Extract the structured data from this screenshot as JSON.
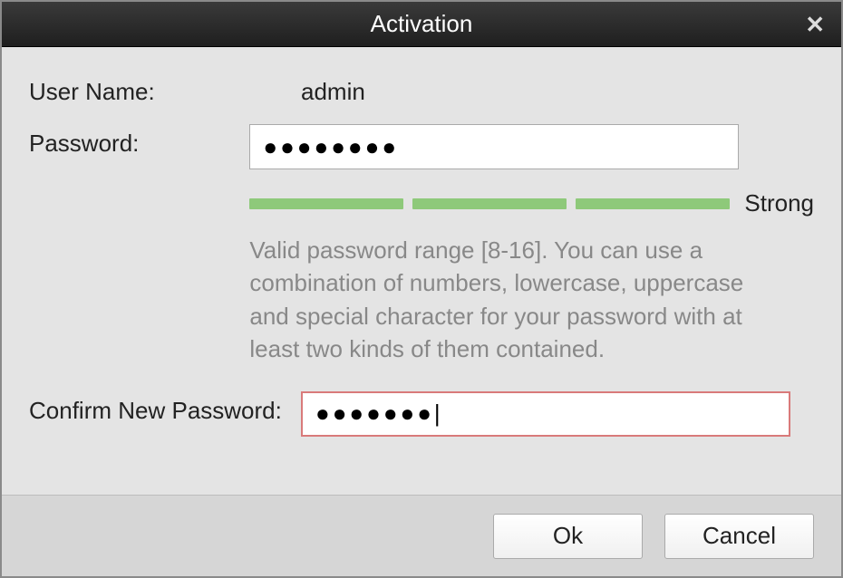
{
  "dialog": {
    "title": "Activation"
  },
  "form": {
    "username_label": "User Name:",
    "username_value": "admin",
    "password_label": "Password:",
    "password_value": "●●●●●●●●",
    "strength_label": "Strong",
    "hint": "Valid password range [8-16]. You can use a combination of numbers, lowercase, uppercase and special character for your password with at least two kinds of them contained.",
    "confirm_label": "Confirm New Password:",
    "confirm_value": "●●●●●●●|"
  },
  "buttons": {
    "ok": "Ok",
    "cancel": "Cancel"
  }
}
